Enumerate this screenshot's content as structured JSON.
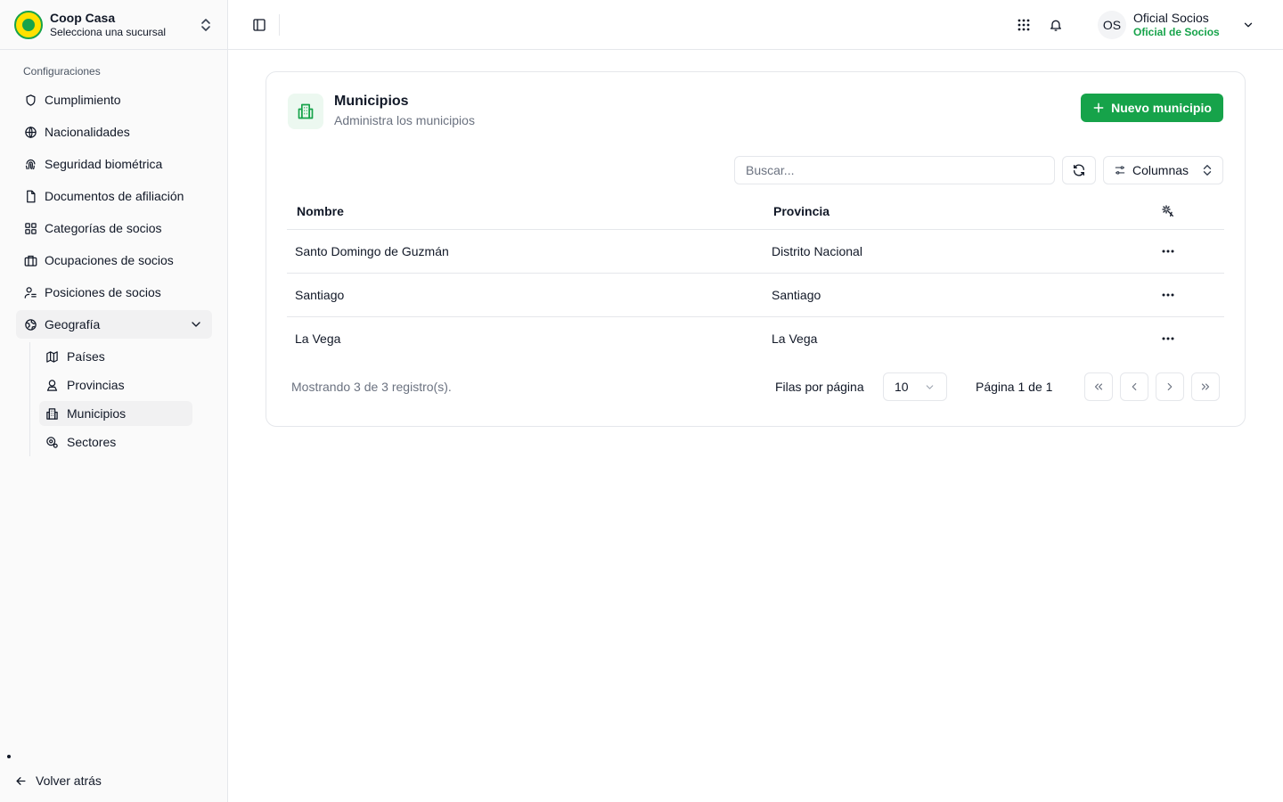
{
  "brand": {
    "name": "Coop Casa",
    "subtitle": "Selecciona una sucursal"
  },
  "sidebar": {
    "section_label": "Configuraciones",
    "items": [
      {
        "label": "Cumplimiento",
        "icon": "shield-icon"
      },
      {
        "label": "Nacionalidades",
        "icon": "globe-icon"
      },
      {
        "label": "Seguridad biométrica",
        "icon": "fingerprint-icon"
      },
      {
        "label": "Documentos de afiliación",
        "icon": "file-icon"
      },
      {
        "label": "Categorías de socios",
        "icon": "grid-icon"
      },
      {
        "label": "Ocupaciones de socios",
        "icon": "briefcase-icon"
      },
      {
        "label": "Posiciones de socios",
        "icon": "users-icon"
      },
      {
        "label": "Geografía",
        "icon": "earth-icon",
        "expanded": true
      }
    ],
    "geo_items": [
      {
        "label": "Países",
        "icon": "map-icon"
      },
      {
        "label": "Provincias",
        "icon": "user-pin-icon"
      },
      {
        "label": "Municipios",
        "icon": "building-icon",
        "active": true
      },
      {
        "label": "Sectores",
        "icon": "location-icon"
      }
    ],
    "back_label": "Volver atrás"
  },
  "user": {
    "initials": "OS",
    "name": "Oficial Socios",
    "role": "Oficial de Socios"
  },
  "page": {
    "title": "Municipios",
    "subtitle": "Administra los municipios",
    "new_button": "Nuevo municipio",
    "search_placeholder": "Buscar...",
    "columns_button": "Columnas"
  },
  "table": {
    "headers": [
      "Nombre",
      "Provincia"
    ],
    "rows": [
      {
        "nombre": "Santo Domingo de Guzmán",
        "provincia": "Distrito Nacional"
      },
      {
        "nombre": "Santiago",
        "provincia": "Santiago"
      },
      {
        "nombre": "La Vega",
        "provincia": "La Vega"
      }
    ]
  },
  "pagination": {
    "summary": "Mostrando 3 de 3 registro(s).",
    "rows_label": "Filas por página",
    "rows_value": "10",
    "page_label": "Página 1 de 1"
  },
  "colors": {
    "accent": "#16a34a",
    "brand_yellow": "#ffe100",
    "border": "#e5e7eb"
  }
}
